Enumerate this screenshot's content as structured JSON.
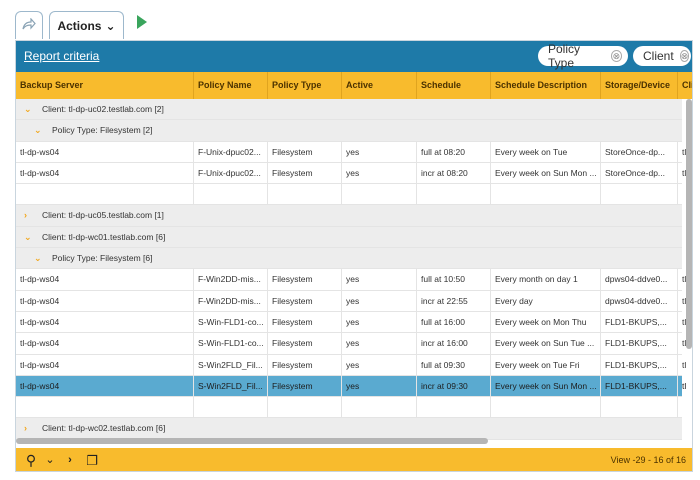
{
  "toolbar": {
    "share_icon": "share-arrow-icon",
    "actions_label": "Actions",
    "actions_chevron": "⌄",
    "run_icon": "play-icon"
  },
  "criteria": {
    "link": "Report criteria",
    "chips": [
      {
        "label": "Policy Type",
        "remove": "⊗"
      },
      {
        "label": "Client",
        "remove": "⊗"
      }
    ]
  },
  "columns": [
    "Backup Server",
    "Policy Name",
    "Policy Type",
    "Active",
    "Schedule",
    "Schedule Description",
    "Storage/Device",
    "Clie"
  ],
  "rows": [
    {
      "kind": "group",
      "level": 0,
      "expanded": true,
      "label": "Client: tl-dp-uc02.testlab.com [2]"
    },
    {
      "kind": "group",
      "level": 1,
      "expanded": true,
      "label": "Policy Type: Filesystem [2]"
    },
    {
      "kind": "data",
      "cells": [
        "tl-dp-ws04",
        "F-Unix-dpuc02...",
        "Filesystem",
        "yes",
        "full at 08:20",
        "Every week on Tue",
        "StoreOnce-dp...",
        "tl"
      ]
    },
    {
      "kind": "data",
      "cells": [
        "tl-dp-ws04",
        "F-Unix-dpuc02...",
        "Filesystem",
        "yes",
        "incr at 08:20",
        "Every week on Sun Mon ...",
        "StoreOnce-dp...",
        "tl"
      ]
    },
    {
      "kind": "blank"
    },
    {
      "kind": "group",
      "level": 0,
      "expanded": false,
      "label": "Client: tl-dp-uc05.testlab.com [1]"
    },
    {
      "kind": "group",
      "level": 0,
      "expanded": true,
      "label": "Client: tl-dp-wc01.testlab.com [6]"
    },
    {
      "kind": "group",
      "level": 1,
      "expanded": true,
      "label": "Policy Type: Filesystem [6]"
    },
    {
      "kind": "data",
      "cells": [
        "tl-dp-ws04",
        "F-Win2DD-mis...",
        "Filesystem",
        "yes",
        "full at 10:50",
        "Every month on day 1",
        "dpws04-ddve0...",
        "tl"
      ]
    },
    {
      "kind": "data",
      "cells": [
        "tl-dp-ws04",
        "F-Win2DD-mis...",
        "Filesystem",
        "yes",
        "incr at 22:55",
        "Every day",
        "dpws04-ddve0...",
        "tl"
      ]
    },
    {
      "kind": "data",
      "cells": [
        "tl-dp-ws04",
        "S-Win-FLD1-co...",
        "Filesystem",
        "yes",
        "full at 16:00",
        "Every week on Mon Thu",
        "FLD1-BKUPS,...",
        "tl"
      ]
    },
    {
      "kind": "data",
      "cells": [
        "tl-dp-ws04",
        "S-Win-FLD1-co...",
        "Filesystem",
        "yes",
        "incr at 16:00",
        "Every week on Sun Tue ...",
        "FLD1-BKUPS,...",
        "tl"
      ]
    },
    {
      "kind": "data",
      "cells": [
        "tl-dp-ws04",
        "S-Win2FLD_Fil...",
        "Filesystem",
        "yes",
        "full at 09:30",
        "Every week on Tue Fri",
        "FLD1-BKUPS,...",
        "tl"
      ]
    },
    {
      "kind": "data",
      "selected": true,
      "cells": [
        "tl-dp-ws04",
        "S-Win2FLD_Fil...",
        "Filesystem",
        "yes",
        "incr at 09:30",
        "Every week on Sun Mon ...",
        "FLD1-BKUPS,...",
        "tl"
      ]
    },
    {
      "kind": "blank"
    },
    {
      "kind": "group",
      "level": 0,
      "expanded": false,
      "label": "Client: tl-dp-wc02.testlab.com [6]"
    }
  ],
  "footer": {
    "search_icon": "⚲",
    "collapse_icon": "⌄",
    "expand_icon": "›",
    "copy_icon": "❐",
    "view_text": "View -29 - 16 of 16"
  }
}
